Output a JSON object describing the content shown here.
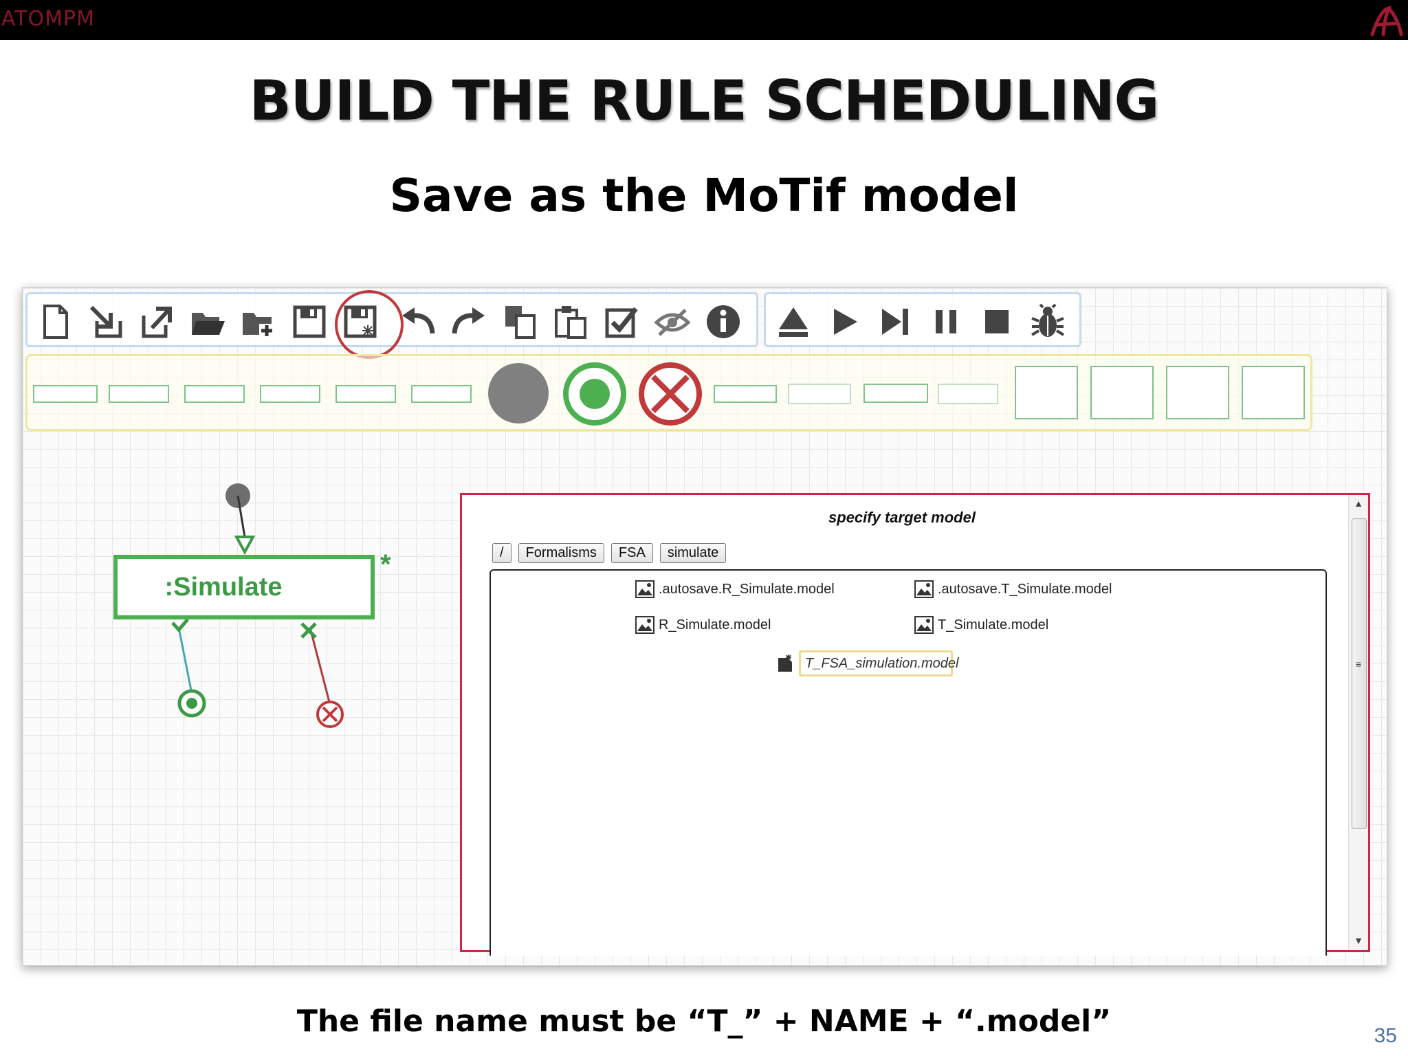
{
  "app": {
    "brand": "ATOMPM"
  },
  "slide": {
    "title": "BUILD THE RULE SCHEDULING",
    "subtitle": "Save as the MoTif model",
    "footer": "The file name must be “T_” + NAME + “.model”",
    "page_number": "35"
  },
  "toolbar": {
    "main_icons": [
      "new-file-icon",
      "import-icon",
      "export-icon",
      "open-folder-icon",
      "new-folder-icon",
      "save-icon",
      "save-as-icon",
      "undo-icon",
      "redo-icon",
      "copy-icon",
      "paste-icon",
      "validate-icon",
      "hide-icon",
      "info-icon"
    ],
    "run_icons": [
      "load-icon",
      "play-icon",
      "step-icon",
      "pause-icon",
      "stop-icon",
      "debug-icon"
    ],
    "highlighted": "save-as-icon"
  },
  "diagram": {
    "rule_label": ":Simulate",
    "star": "*"
  },
  "dialog": {
    "title": "specify target model",
    "breadcrumbs": [
      "/",
      "Formalisms",
      "FSA",
      "simulate"
    ],
    "files": [
      ".autosave.R_Simulate.model",
      ".autosave.T_Simulate.model",
      "R_Simulate.model",
      "T_Simulate.model"
    ],
    "new_file_value": "T_FSA_simulation.model"
  },
  "colors": {
    "accent_red": "#c0393b",
    "rule_green": "#4caf50",
    "dialog_border": "#d0244a"
  }
}
